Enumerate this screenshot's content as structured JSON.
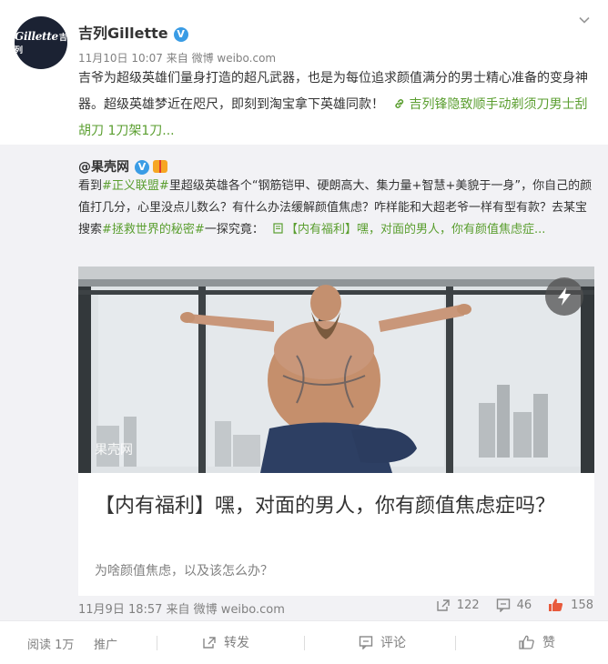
{
  "author": {
    "avatar_text": "Gillette",
    "avatar_text_cn": "吉列",
    "name": "吉列Gillette",
    "verified_mark": "V"
  },
  "post": {
    "meta": "11月10日 10:07 来自 微博 weibo.com",
    "text": "吉爷为超级英雄们量身打造的超凡武器，也是为每位追求颜值满分的男士精心准备的变身神器。超级英雄梦近在咫尺，即刻到淘宝拿下英雄同款！",
    "link_text": "吉列锋隐致顺手动剃须刀男士刮胡刀 1刀架1刀..."
  },
  "repost": {
    "author": "@果壳网",
    "verified_mark": "V",
    "text_parts": {
      "p1": "看到",
      "tag1": "#正义联盟#",
      "p2": "里超级英雄各个“钢筋铠甲、硬朗高大、集力量+智慧+美貌于一身”，你自己的颜值打几分，心里没点儿数么？有什么办法缓解颜值焦虑？咋样能和大超老爷一样有型有款？去某宝搜索",
      "tag2": "#拯救世界的秘密#",
      "p3": "一探究竟：",
      "link": "【内有福利】嘿，对面的男人，你有颜值焦虑症..."
    },
    "media_watermark": "果壳网",
    "article_title": "【内有福利】嘿，对面的男人，你有颜值焦虑症吗？",
    "article_subtitle": "为啥颜值焦虑，以及该怎么办？",
    "meta": "11月9日 18:57 来自 微博 weibo.com",
    "stats": {
      "reposts": "122",
      "comments": "46",
      "likes": "158"
    }
  },
  "footer": {
    "reads": "阅读 1万",
    "promote": "推广",
    "repost_label": "转发",
    "comment_label": "评论",
    "like_label": "赞"
  },
  "colors": {
    "link": "#5a9e2f",
    "verified": "#3a9ce5",
    "like": "#e85a3c",
    "repost_bg": "#f2f2f5"
  },
  "icons": [
    "chevron-down-icon",
    "verified-icon",
    "gift-icon",
    "link-icon",
    "article-icon",
    "flash-icon",
    "repost-icon",
    "comment-icon",
    "like-icon"
  ]
}
